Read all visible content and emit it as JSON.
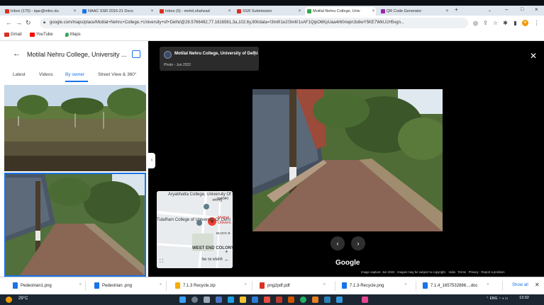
{
  "browser": {
    "tabs": [
      {
        "label": "Inbox (179) - iqac@mlnc.du",
        "favicon": "#d93025"
      },
      {
        "label": "NAAC SSR 2016-21 Docs",
        "favicon": "#1a73e8"
      },
      {
        "label": "Inbox (5) - mohd.shahzad",
        "favicon": "#d93025"
      },
      {
        "label": "SSR Submission",
        "favicon": "#d93025"
      },
      {
        "label": "Motilal Nehru College, Univ",
        "favicon": "#34a853"
      },
      {
        "label": "QR Code Generator",
        "favicon": "#9c27b0"
      }
    ],
    "active_tab": 4,
    "url": "google.com/maps/place/Motilal+Nehru+College,+University+of+Delhi/@28.5766492,77.1616561,3a,102.6y,90t/data=!3m8!1e2!3m6!1sAF1QipO6KpUaa4r60rwpn3s6wY5KE7WkU1H5vgn...",
    "bookmarks": [
      {
        "label": "Gmail",
        "color": "#d93025"
      },
      {
        "label": "YouTube",
        "color": "#ff0000"
      },
      {
        "label": "Maps",
        "color": "#34a853"
      }
    ]
  },
  "left_panel": {
    "title": "Motilal Nehru College, University ...",
    "tabs": [
      "Latest",
      "Videos",
      "By owner",
      "Street View & 360°"
    ],
    "selected_tab": 2
  },
  "viewer": {
    "place": "Motilal Nehru College, University of Delhi",
    "photo_date": "Photo - Jun 2022",
    "map_labels": {
      "aryabhatta": "Aryabhatta College, University Of Delhi",
      "aryabhatta_hi": "आर्यभट्ट",
      "tularam": "TulaRam College of University Of Delhi",
      "motilal": "Motilal Univers",
      "west_end": "WEST END COLONY",
      "west_end_hi": "वेस्ट एंड कॉलोनी",
      "block": "BLOCK B",
      "road": "एसएसए"
    },
    "google_logo": "Google",
    "footer": [
      "Image capture: Jun 2022",
      "Images may be subject to copyright.",
      "India",
      "Terms",
      "Privacy",
      "Report a problem"
    ]
  },
  "downloads": {
    "items": [
      {
        "name": "Pedestrian1.png",
        "color": "#1a73e8"
      },
      {
        "name": "Pedestrian .png",
        "color": "#1a73e8"
      },
      {
        "name": "7.1.3 Recycle.zip",
        "color": "#f9ab00"
      },
      {
        "name": "png2pdf.pdf",
        "color": "#d93025"
      },
      {
        "name": "7.1.3-Recycle.png",
        "color": "#1a73e8"
      },
      {
        "name": "7.1.4_1657532886....doc",
        "color": "#1a73e8"
      }
    ],
    "show_all": "Show all"
  },
  "taskbar": {
    "weather": "29°C",
    "tray_lang": "ENG",
    "time": "13:32"
  }
}
